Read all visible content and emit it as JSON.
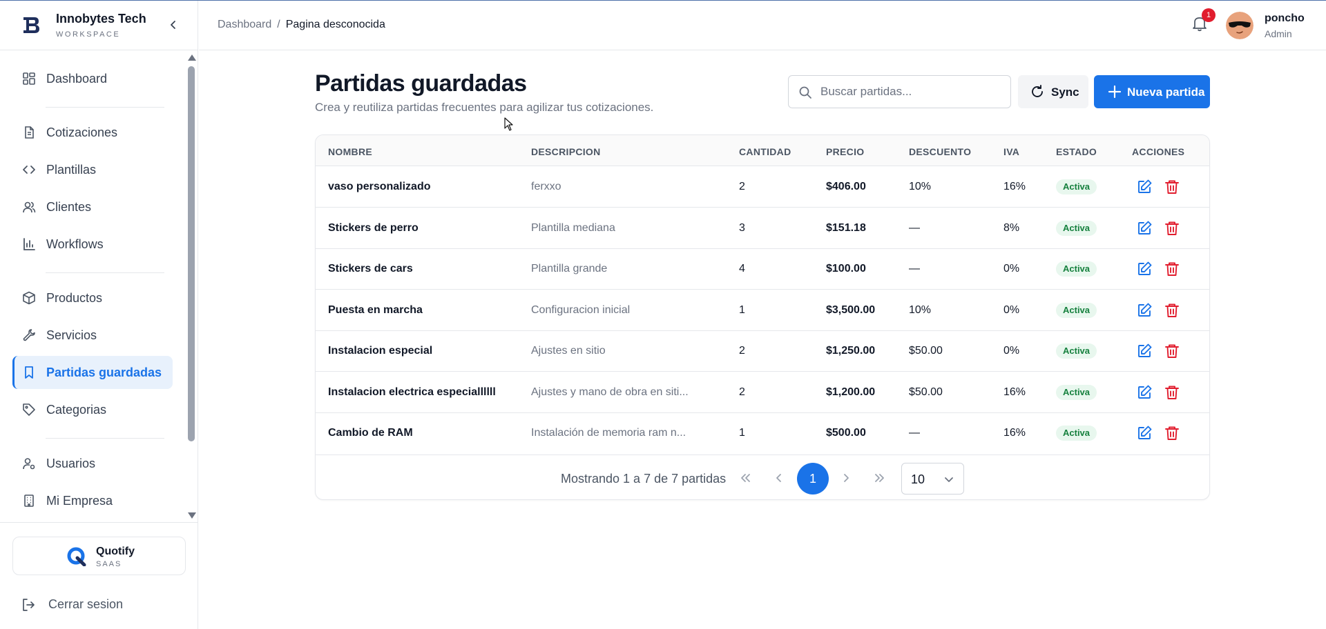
{
  "brand": {
    "name": "Innobytes Tech",
    "subtitle": "WORKSPACE",
    "logo_icon": "innobytes-logo"
  },
  "sidebar": {
    "items": [
      {
        "label": "Dashboard",
        "icon": "grid-icon",
        "active": false
      },
      {
        "label": "Cotizaciones",
        "icon": "document-icon",
        "active": false
      },
      {
        "label": "Plantillas",
        "icon": "code-icon",
        "active": false
      },
      {
        "label": "Clientes",
        "icon": "users-icon",
        "active": false
      },
      {
        "label": "Workflows",
        "icon": "bar-chart-icon",
        "active": false
      },
      {
        "label": "Productos",
        "icon": "box-icon",
        "active": false
      },
      {
        "label": "Servicios",
        "icon": "wrench-icon",
        "active": false
      },
      {
        "label": "Partidas guardadas",
        "icon": "bookmark-icon",
        "active": true
      },
      {
        "label": "Categorias",
        "icon": "tag-icon",
        "active": false
      },
      {
        "label": "Usuarios",
        "icon": "user-cog-icon",
        "active": false
      },
      {
        "label": "Mi Empresa",
        "icon": "building-icon",
        "active": false
      }
    ],
    "footer": {
      "product_name": "Quotify",
      "product_sub": "SAAS",
      "logout_label": "Cerrar sesion"
    }
  },
  "header": {
    "breadcrumb": {
      "root": "Dashboard",
      "separator": "/",
      "current": "Pagina desconocida"
    },
    "notifications_count": "1",
    "user": {
      "name": "poncho",
      "role": "Admin"
    }
  },
  "main": {
    "title": "Partidas guardadas",
    "subtitle": "Crea y reutiliza partidas frecuentes para agilizar tus cotizaciones.",
    "search": {
      "placeholder": "Buscar partidas..."
    },
    "sync_label": "Sync",
    "new_label": "Nueva partida",
    "table": {
      "columns": [
        "NOMBRE",
        "DESCRIPCION",
        "CANTIDAD",
        "PRECIO",
        "DESCUENTO",
        "IVA",
        "ESTADO",
        "ACCIONES"
      ],
      "rows": [
        {
          "nombre": "vaso personalizado",
          "descripcion": "ferxxo",
          "cantidad": "2",
          "precio": "$406.00",
          "descuento": "10%",
          "iva": "16%",
          "estado": "Activa"
        },
        {
          "nombre": "Stickers de perro",
          "descripcion": "Plantilla mediana",
          "cantidad": "3",
          "precio": "$151.18",
          "descuento": "—",
          "iva": "8%",
          "estado": "Activa"
        },
        {
          "nombre": "Stickers de cars",
          "descripcion": "Plantilla grande",
          "cantidad": "4",
          "precio": "$100.00",
          "descuento": "—",
          "iva": "0%",
          "estado": "Activa"
        },
        {
          "nombre": "Puesta en marcha",
          "descripcion": "Configuracion inicial",
          "cantidad": "1",
          "precio": "$3,500.00",
          "descuento": "10%",
          "iva": "0%",
          "estado": "Activa"
        },
        {
          "nombre": "Instalacion especial",
          "descripcion": "Ajustes en sitio",
          "cantidad": "2",
          "precio": "$1,250.00",
          "descuento": "$50.00",
          "iva": "0%",
          "estado": "Activa"
        },
        {
          "nombre": "Instalacion electrica especiallllll",
          "descripcion": "Ajustes y mano de obra en siti...",
          "cantidad": "2",
          "precio": "$1,200.00",
          "descuento": "$50.00",
          "iva": "16%",
          "estado": "Activa"
        },
        {
          "nombre": "Cambio de RAM",
          "descripcion": "Instalación de memoria ram n...",
          "cantidad": "1",
          "precio": "$500.00",
          "descuento": "—",
          "iva": "16%",
          "estado": "Activa"
        }
      ]
    },
    "pagination": {
      "summary": "Mostrando 1 a 7 de 7 partidas",
      "current_page": "1",
      "page_size": "10"
    }
  },
  "colors": {
    "primary": "#1a73e8",
    "danger": "#e11d2e",
    "success_bg": "#e8f7ee",
    "success_text": "#15803d"
  }
}
